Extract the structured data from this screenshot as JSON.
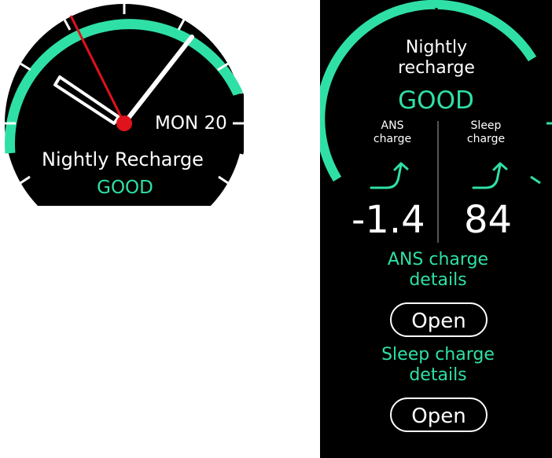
{
  "left_watch": {
    "date": "MON 20",
    "title": "Nightly Recharge",
    "status": "GOOD"
  },
  "right_watch": {
    "title": "Nightly recharge",
    "status": "GOOD",
    "ans": {
      "label": "ANS charge",
      "value": "-1.4",
      "trend_icon": "trend-up-arrow-icon"
    },
    "sleep": {
      "label": "Sleep charge",
      "value": "84",
      "trend_icon": "trend-up-arrow-icon"
    },
    "ans_details_label": "ANS charge details",
    "ans_open_label": "Open",
    "sleep_details_label": "Sleep charge details",
    "sleep_open_label": "Open"
  },
  "colors": {
    "accent": "#2fe0a6",
    "second_hand": "#e0121b",
    "background": "#000000",
    "text": "#ffffff"
  }
}
